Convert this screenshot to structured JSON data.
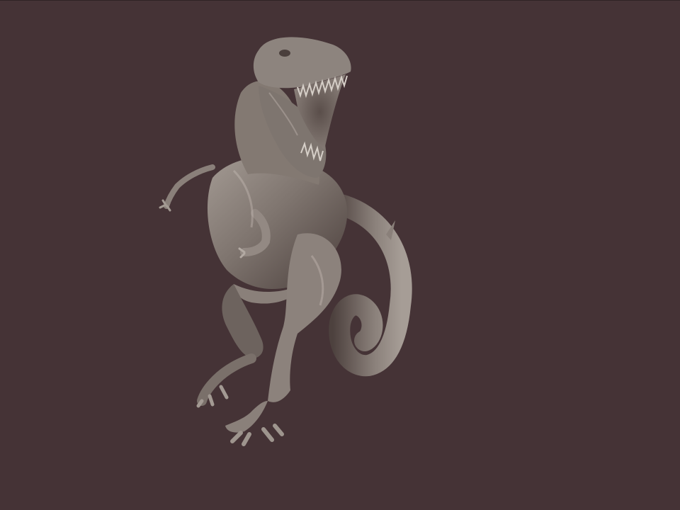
{
  "scene": {
    "background_color": "#453336",
    "subject": "trex-sculpt-model",
    "model_base_color": "#7f756f",
    "model_shadow_color": "#3a2f2c",
    "model_highlight_color": "#b3aaa3"
  }
}
